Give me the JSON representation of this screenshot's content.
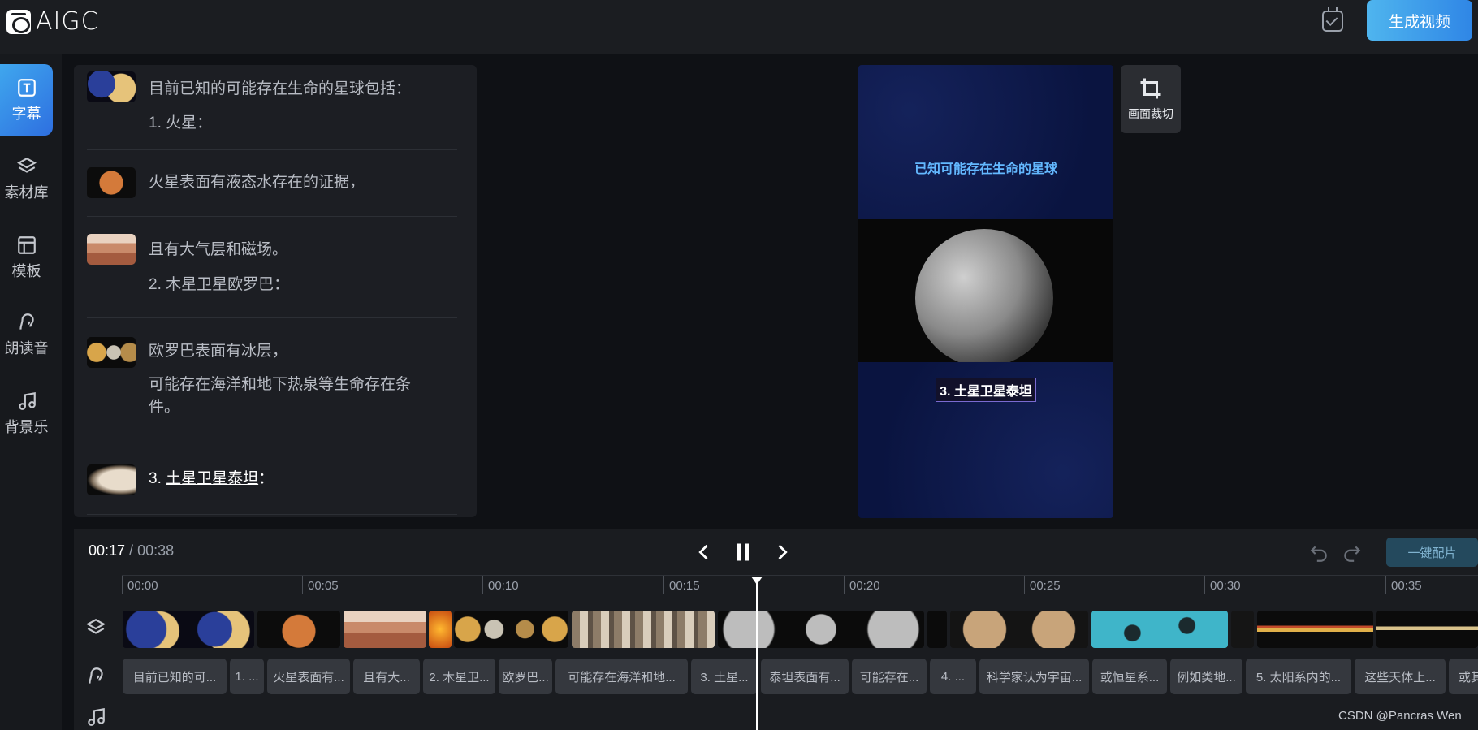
{
  "app": {
    "logo_text": "AIGC",
    "generate_button": "生成视频"
  },
  "sidebar": {
    "items": [
      {
        "label": "字幕",
        "icon": "subtitle-icon",
        "active": true
      },
      {
        "label": "素材库",
        "icon": "layers-icon",
        "active": false
      },
      {
        "label": "模板",
        "icon": "template-icon",
        "active": false
      },
      {
        "label": "朗读音",
        "icon": "voice-icon",
        "active": false
      },
      {
        "label": "背景乐",
        "icon": "music-icon",
        "active": false
      }
    ]
  },
  "subtitles": [
    {
      "lines": [
        "目前已知的可能存在生命的星球包括：",
        "1. 火星："
      ]
    },
    {
      "lines": [
        "火星表面有液态水存在的证据，"
      ]
    },
    {
      "lines": [
        "且有大气层和磁场。",
        "2. 木星卫星欧罗巴："
      ]
    },
    {
      "lines": [
        "欧罗巴表面有冰层，",
        "可能存在海洋和地下热泉等生命存在条",
        "件。"
      ]
    },
    {
      "prefix": "3. ",
      "highlight": "土星卫星泰坦",
      "suffix": "：",
      "active": true
    }
  ],
  "preview": {
    "title": "已知可能存在生命的星球",
    "caption": "3. 土星卫星泰坦",
    "crop_button": "画面裁切"
  },
  "timeline": {
    "current": "00:17",
    "separator": " / ",
    "total": "00:38",
    "auto_match_button": "一键配片",
    "ticks": [
      "00:00",
      "00:05",
      "00:10",
      "00:15",
      "00:20",
      "00:25",
      "00:30",
      "00:35"
    ],
    "subtitle_clips": [
      "目前已知的可...",
      "1. ...",
      "火星表面有...",
      "且有大...",
      "2. 木星卫...",
      "欧罗巴...",
      "可能存在海洋和地...",
      "3. 土星...",
      "泰坦表面有...",
      "可能存在...",
      "4. ...",
      "科学家认为宇宙...",
      "或恒星系...",
      "例如类地...",
      "5. 太阳系内的...",
      "这些天体上...",
      "或其"
    ]
  },
  "watermark": "CSDN @Pancras Wen",
  "colors": {
    "accent": "#3fa7ee",
    "background": "#0f1115",
    "panel": "#1c1e23"
  }
}
